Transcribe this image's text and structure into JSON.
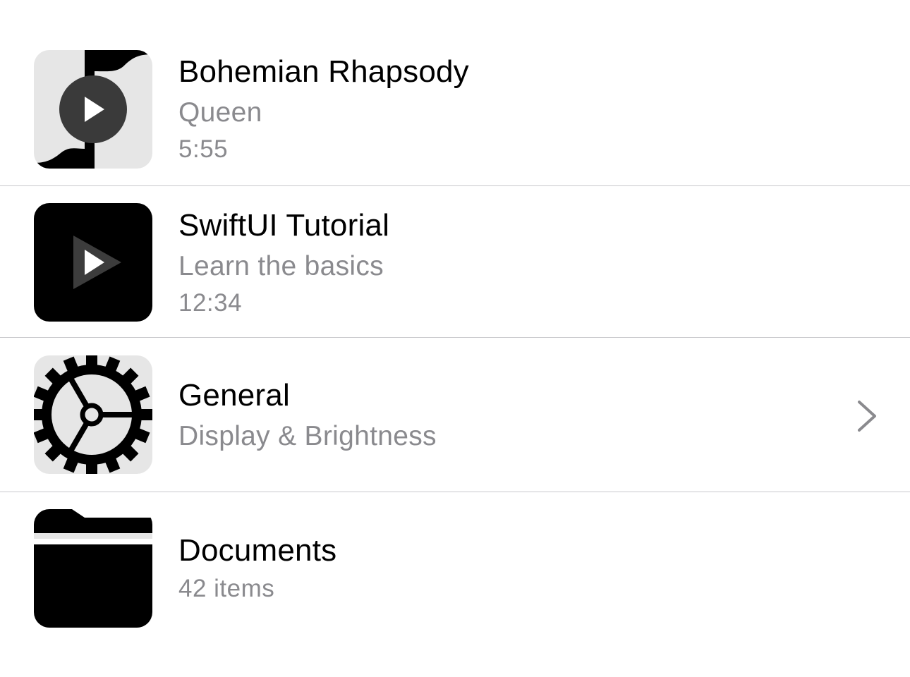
{
  "list": {
    "items": [
      {
        "title": "Bohemian Rhapsody",
        "subtitle": "Queen",
        "meta": "5:55",
        "icon": "music-note-play-icon"
      },
      {
        "title": "SwiftUI Tutorial",
        "subtitle": "Learn the basics",
        "meta": "12:34",
        "icon": "video-play-icon"
      },
      {
        "title": "General",
        "subtitle": "Display & Brightness",
        "icon": "gear-icon",
        "accessory": "chevron-right-icon"
      },
      {
        "title": "Documents",
        "meta": "42 items",
        "icon": "folder-icon"
      }
    ]
  },
  "colors": {
    "title": "#000000",
    "secondary": "#8a8a8e",
    "separator": "#c8c8cc",
    "thumb_background": "#e8e8e8"
  }
}
